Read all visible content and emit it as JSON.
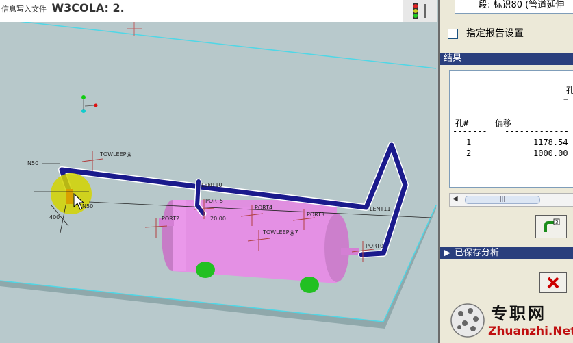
{
  "toolbar": {
    "message": "信息写入文件",
    "watermark": "W3COLA: 2."
  },
  "model": {
    "dimensions": {
      "d1": "N50",
      "d2": "400",
      "d3": "N50",
      "d4": "20.00"
    },
    "labels": {
      "tohleep": "TOWLEEP@",
      "lent": "LENT10",
      "port5": "PORT5",
      "port2": "PORT2",
      "port4": "PORT4",
      "port3": "PORT3",
      "tohleep2": "TOWLEEP@7",
      "lent11": "LENT11",
      "port0": "PORT0"
    }
  },
  "panel": {
    "segment_label": "段: 标识80 (管道延伸",
    "report_setting_label": "指定报告设置",
    "results_header": "结果",
    "results": {
      "title_char": "孔",
      "col_hole": "孔#",
      "col_offset": "偏移",
      "rows": [
        {
          "hole": "1",
          "offset": "1178.54"
        },
        {
          "hole": "2",
          "offset": "1000.00"
        }
      ]
    },
    "saved_analysis_label": "已保存分析"
  },
  "brand": {
    "cn": "专职网",
    "en": "Zhuanzhi.Net"
  },
  "colors": {
    "pipe": "#1a1a8c",
    "tank": "#e08fe0",
    "support": "#22c022",
    "selection": "#d4d400",
    "header": "#2a3f7d"
  }
}
